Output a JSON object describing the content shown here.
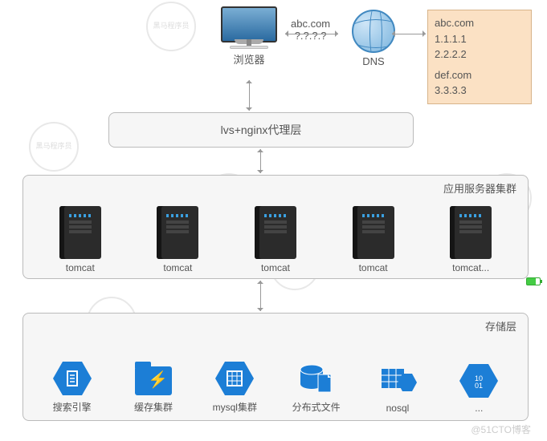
{
  "watermark_text": "黑马程序员",
  "top": {
    "browser_label": "浏览器",
    "dns_label": "DNS",
    "request_domain": "abc.com",
    "request_ip": "?.?.?.?"
  },
  "dns_records": {
    "block1_domain": "abc.com",
    "block1_ip1": "1.1.1.1",
    "block1_ip2": "2.2.2.2",
    "block2_domain": "def.com",
    "block2_ip1": "3.3.3.3"
  },
  "proxy": {
    "label": "lvs+nginx代理层"
  },
  "app_cluster": {
    "title": "应用服务器集群",
    "servers": [
      "tomcat",
      "tomcat",
      "tomcat",
      "tomcat",
      "tomcat..."
    ]
  },
  "storage_cluster": {
    "title": "存储层",
    "items": [
      "搜索引擎",
      "缓存集群",
      "mysql集群",
      "分布式文件",
      "nosql",
      "..."
    ]
  },
  "footer_watermark": "@51CTO博客"
}
